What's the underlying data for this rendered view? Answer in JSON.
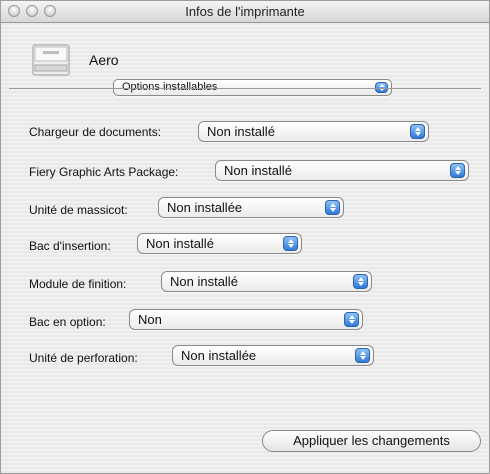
{
  "window": {
    "title": "Infos de l'imprimante"
  },
  "printer": {
    "name": "Aero",
    "icon": "printer-icon"
  },
  "section_popup": {
    "value": "Options installables"
  },
  "options": [
    {
      "label": "Chargeur de documents:",
      "value": "Non installé"
    },
    {
      "label": "Fiery Graphic Arts Package:",
      "value": "Non installé"
    },
    {
      "label": "Unité de massicot:",
      "value": "Non installée"
    },
    {
      "label": "Bac d'insertion:",
      "value": "Non installé"
    },
    {
      "label": "Module de finition:",
      "value": "Non installé"
    },
    {
      "label": "Bac en option:",
      "value": "Non"
    },
    {
      "label": "Unité de perforation:",
      "value": "Non installée"
    }
  ],
  "apply_button": {
    "label": "Appliquer les changements"
  },
  "colors": {
    "accent": "#2f79d9"
  }
}
